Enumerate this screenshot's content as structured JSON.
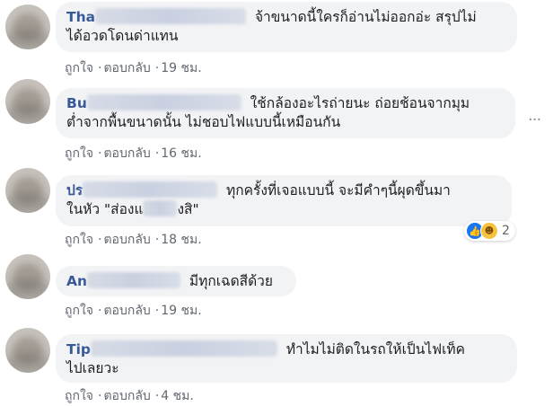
{
  "comments": [
    {
      "name": "Tha",
      "text_line1": "จ้าขนาดนี้ใครก็อ่านไม่ออกอ่ะ สรุปไม่",
      "text_line2": "ได้อวดโดนด่าแทน",
      "like": "ถูกใจ",
      "reply": "ตอบกลับ",
      "time": "19 ชม."
    },
    {
      "name": "Bu",
      "text_line1": "ใช้กล้องอะไรถ่ายนะ ถ่อยช้อนจากมุม",
      "text_line2": "ต่ำจากพื้นขนาดนั้น ไม่ชอบไฟแบบนี้เหมือนกัน",
      "like": "ถูกใจ",
      "reply": "ตอบกลับ",
      "time": "16 ชม."
    },
    {
      "name": "ปร",
      "text_line1": "ทุกครั้งที่เจอแบบนี้ จะมีคำๆนี้ผุดขึ้นมา",
      "text_line2_a": "ในหัว \"ส่องแ",
      "text_line2_b": "งสิ\"",
      "like": "ถูกใจ",
      "reply": "ตอบกลับ",
      "time": "18 ชม.",
      "reaction_count": "2"
    },
    {
      "name": "An",
      "text_line1": "มีทุกเฉดสีด้วย",
      "like": "ถูกใจ",
      "reply": "ตอบกลับ",
      "time": "19 ชม."
    },
    {
      "name": "Tip",
      "text_line1": "ทำไมไม่ติดในรถให้เป็นไฟเท็ค",
      "text_line2": "ไปเลยวะ",
      "like": "ถูกใจ",
      "reply": "ตอบกลับ",
      "time": "4 ชม."
    }
  ],
  "separator": "·",
  "more_icon": "···",
  "colors": {
    "name": "#385898",
    "bubble": "#f2f3f5",
    "meta": "#616770",
    "like": "#1877f2",
    "haha": "#f7c240"
  }
}
